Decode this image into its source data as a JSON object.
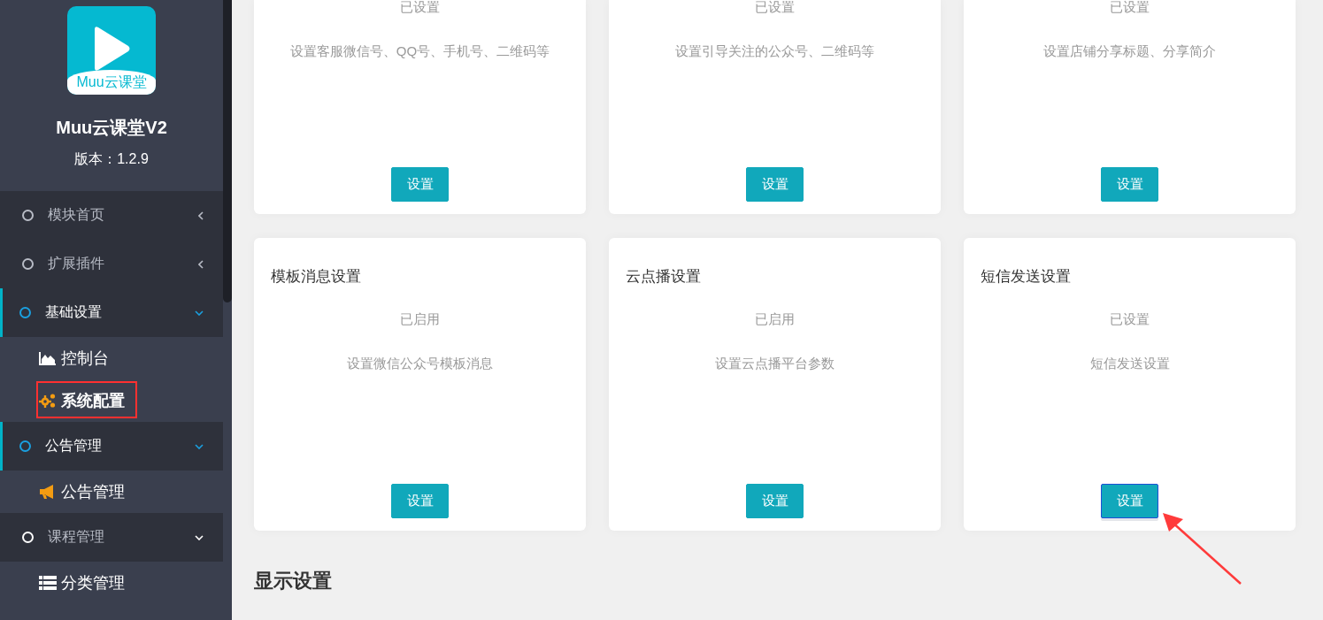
{
  "sidebar": {
    "logo": {
      "caption": "Muu云课堂"
    },
    "title": "Muu云课堂V2",
    "version": "版本：1.2.9",
    "menu": [
      {
        "label": "模块首页",
        "expanded": false,
        "active": false
      },
      {
        "label": "扩展插件",
        "expanded": false,
        "active": false
      },
      {
        "label": "基础设置",
        "expanded": true,
        "active": true,
        "children": [
          {
            "label": "控制台",
            "kind": "chart",
            "selected": false,
            "highlighted": false
          },
          {
            "label": "系统配置",
            "kind": "gears",
            "selected": true,
            "highlighted": true
          }
        ]
      },
      {
        "label": "公告管理",
        "expanded": true,
        "active": true,
        "children": [
          {
            "label": "公告管理",
            "kind": "megaphone",
            "selected": false,
            "highlighted": false
          }
        ]
      },
      {
        "label": "课程管理",
        "expanded": true,
        "active": false,
        "children": [
          {
            "label": "分类管理",
            "kind": "list",
            "selected": false,
            "highlighted": false
          }
        ]
      }
    ]
  },
  "sections": [
    {
      "cards": [
        {
          "status": "已设置",
          "description": "设置客服微信号、QQ号、手机号、二维码等",
          "button": "设置",
          "focused": false,
          "pointed_at": false
        },
        {
          "status": "已设置",
          "description": "设置引导关注的公众号、二维码等",
          "button": "设置",
          "focused": false,
          "pointed_at": false
        },
        {
          "status": "已设置",
          "description": "设置店铺分享标题、分享简介",
          "button": "设置",
          "focused": false,
          "pointed_at": false
        },
        {
          "title": "模板消息设置",
          "status": "已启用",
          "description": "设置微信公众号模板消息",
          "button": "设置",
          "focused": false,
          "pointed_at": false
        },
        {
          "title": "云点播设置",
          "status": "已启用",
          "description": "设置云点播平台参数",
          "button": "设置",
          "focused": false,
          "pointed_at": false
        },
        {
          "title": "短信发送设置",
          "status": "已设置",
          "description": "短信发送设置",
          "button": "设置",
          "focused": true,
          "pointed_at": true
        }
      ]
    },
    {
      "heading": "显示设置"
    }
  ]
}
